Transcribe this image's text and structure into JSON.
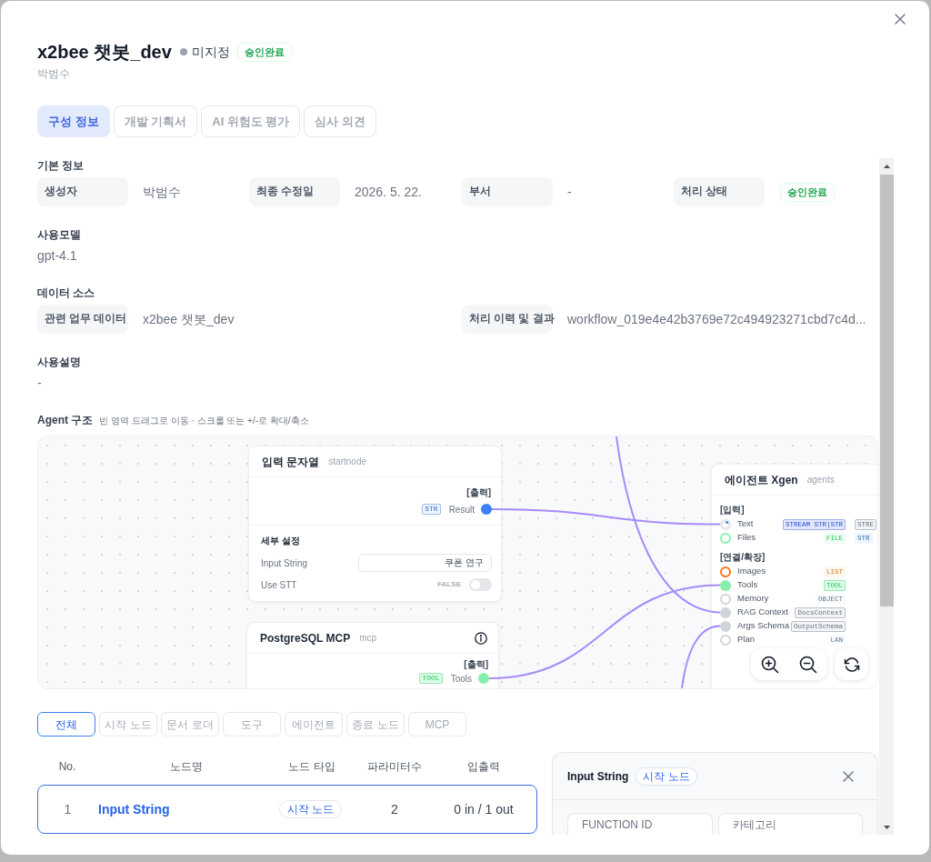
{
  "modal": {
    "title": "x2bee 챗봇_dev",
    "visibility": "미지정",
    "status": "승인완료",
    "owner": "박범수"
  },
  "tabs": [
    {
      "label": "구성 정보",
      "selected": true
    },
    {
      "label": "개발 기획서",
      "selected": false
    },
    {
      "label": "AI 위험도 평가",
      "selected": false
    },
    {
      "label": "심사 의견",
      "selected": false
    }
  ],
  "basic_info": {
    "title": "기본 정보",
    "fields": [
      {
        "kind": "text",
        "label": "생성자",
        "value": "박범수"
      },
      {
        "kind": "text",
        "label": "최종 수정일",
        "value": "2026. 5. 22."
      },
      {
        "kind": "text",
        "label": "부서",
        "value": "-"
      },
      {
        "kind": "badge",
        "label": "처리 상태",
        "value": "승인완료"
      }
    ]
  },
  "model": {
    "title": "사용모델",
    "value": "gpt-4.1"
  },
  "data_source": {
    "title": "데이터 소스",
    "fields": [
      {
        "kind": "text",
        "label": "관련 업무 데이터",
        "value": "x2bee 챗봇_dev"
      },
      {
        "kind": "text",
        "label": "처리 이력 및 결과",
        "value": "workflow_019e4e42b3769e72c494923271cbd7c4d..."
      }
    ]
  },
  "description": {
    "title": "사용설명",
    "value": "-"
  },
  "agent_structure": {
    "title": "Agent 구조",
    "hint": "빈 영역 드래그로 이동 · 스크롤 또는 +/-로 확대/축소",
    "nodes": [
      {
        "title": "입력 문자열",
        "type": "startnode",
        "outputs": {
          "title": "[출력]",
          "ports": [
            {
              "label": "Result",
              "kind": "filled",
              "color": "#3b82f6",
              "types": [
                {
                  "text": "STR",
                  "color": "#eff6ff",
                  "outlined": true
                }
              ]
            }
          ]
        },
        "settings": {
          "title": "세부 설정",
          "fields": [
            {
              "kind": "text",
              "label": "Input String",
              "value": "쿠폰 연구"
            },
            {
              "kind": "toggle",
              "label": "Use STT",
              "value_label": "FALSE",
              "on": false
            }
          ]
        }
      },
      {
        "title": "PostgreSQL MCP",
        "type": "mcp",
        "info_button": true,
        "outputs": {
          "title": "[출력]",
          "ports": [
            {
              "label": "Tools",
              "kind": "filled",
              "color": "#86efac",
              "types": [
                {
                  "text": "TOOL",
                  "color": "#dcfce7",
                  "outlined": true
                }
              ]
            }
          ]
        }
      },
      {
        "title": "에이전트 Xgen",
        "type": "agents",
        "input_groups": [
          {
            "title": "[입력]",
            "ports": [
              {
                "label": "Text",
                "kind": "focused",
                "color": "#e5e7eb",
                "types": [
                  {
                    "text": "STREAM STR|STR",
                    "color": "#e0e7ff",
                    "outlined": true
                  },
                  {
                    "text": "STRE",
                    "color": "#f3f4f6",
                    "outlined": true
                  }
                ]
              },
              {
                "label": "Files",
                "kind": "ring",
                "color": "#86efac",
                "types": [
                  {
                    "text": "FILE",
                    "color": "#f0fdf4",
                    "outlined": false
                  },
                  {
                    "text": "STR",
                    "color": "#eff6ff",
                    "outlined": false
                  }
                ]
              }
            ]
          },
          {
            "title": "[연결/확장]",
            "ports": [
              {
                "label": "Images",
                "kind": "ring",
                "color": "#f97316",
                "types": [
                  {
                    "text": "LIST",
                    "color": "#fff7ed",
                    "outlined": false
                  }
                ]
              },
              {
                "label": "Tools",
                "kind": "filled",
                "color": "#86efac",
                "types": [
                  {
                    "text": "TOOL",
                    "color": "#dcfce7",
                    "outlined": true
                  }
                ]
              },
              {
                "label": "Memory",
                "kind": "ring",
                "color": "#d1d5db",
                "types": [
                  {
                    "text": "OBJECT",
                    "color": "#f9fafb",
                    "outlined": false
                  }
                ]
              },
              {
                "label": "RAG Context",
                "kind": "filled",
                "color": "#d1d5db",
                "types": [
                  {
                    "text": "DocsContext",
                    "color": "#f3f4f6",
                    "outlined": true
                  }
                ]
              },
              {
                "label": "Args Schema",
                "kind": "filled",
                "color": "#d1d5db",
                "types": [
                  {
                    "text": "OutputSchema",
                    "color": "#f3f4f6",
                    "outlined": true
                  }
                ]
              },
              {
                "label": "Plan",
                "kind": "ring",
                "color": "#d1d5db",
                "types": [
                  {
                    "text": "LAN",
                    "color": "#f9fafb",
                    "outlined": false
                  }
                ]
              }
            ]
          }
        ]
      }
    ]
  },
  "filters": [
    {
      "label": "전체",
      "selected": true
    },
    {
      "label": "시작 노드",
      "selected": false
    },
    {
      "label": "문서 로더",
      "selected": false
    },
    {
      "label": "도구",
      "selected": false
    },
    {
      "label": "에이전트",
      "selected": false
    },
    {
      "label": "종료 노드",
      "selected": false
    },
    {
      "label": "MCP",
      "selected": false
    }
  ],
  "node_table": {
    "columns": [
      "No.",
      "노드명",
      "노드 타입",
      "파라미터수",
      "입출력"
    ],
    "rows": [
      {
        "no": "1",
        "name": "Input String",
        "type": "시작 노드",
        "params": "2",
        "io": "0 in / 1 out",
        "selected": true
      }
    ]
  },
  "detail_panel": {
    "title": "Input String",
    "badge": "시작 노드",
    "cards": [
      {
        "label": "FUNCTION ID"
      },
      {
        "label": "카테고리"
      }
    ]
  }
}
